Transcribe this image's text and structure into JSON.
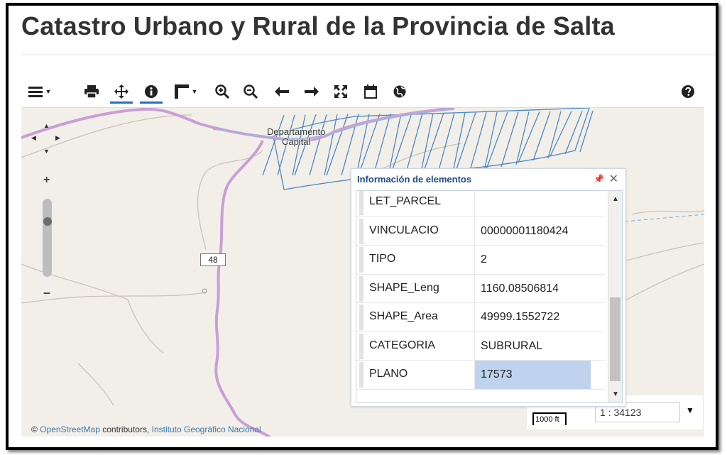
{
  "page": {
    "title": "Catastro Urbano y Rural de la Provincia de Salta"
  },
  "toolbar": {
    "tools": [
      {
        "id": "menu",
        "icon": "hamburger-menu-icon"
      },
      {
        "id": "print",
        "icon": "print-icon"
      },
      {
        "id": "pan",
        "icon": "move-icon"
      },
      {
        "id": "info",
        "icon": "info-icon"
      },
      {
        "id": "measure",
        "icon": "measure-ruler-icon"
      },
      {
        "id": "zoom-in",
        "icon": "zoom-in-icon"
      },
      {
        "id": "zoom-out",
        "icon": "zoom-out-icon"
      },
      {
        "id": "back",
        "icon": "arrow-left-icon"
      },
      {
        "id": "forward",
        "icon": "arrow-right-icon"
      },
      {
        "id": "full-extent",
        "icon": "expand-icon"
      },
      {
        "id": "calendar",
        "icon": "calendar-icon"
      },
      {
        "id": "globe",
        "icon": "globe-icon"
      },
      {
        "id": "help",
        "icon": "help-icon"
      }
    ],
    "active_tools": [
      "pan",
      "info"
    ]
  },
  "map": {
    "place_label": "Departamento\nCapital",
    "route_number": "48",
    "attribution": {
      "osm": "OpenStreetMap",
      "middle": "contributors,",
      "ign": "Instituto Geográfico Nacional"
    },
    "scale": {
      "bar_label": "1000 ft",
      "value": "1 : 34123"
    },
    "colors": {
      "background": "#f2efe9",
      "road": "#c99fd6",
      "parcel": "#4a88c6"
    }
  },
  "info_panel": {
    "title": "Información de elementos",
    "rows": [
      {
        "key": "LET_PARCEL",
        "value": ""
      },
      {
        "key": "VINCULACIO",
        "value": "00000001180424"
      },
      {
        "key": "TIPO",
        "value": "2"
      },
      {
        "key": "SHAPE_Leng",
        "value": "1160.08506814"
      },
      {
        "key": "SHAPE_Area",
        "value": "49999.1552722"
      },
      {
        "key": "CATEGORIA",
        "value": "SUBRURAL"
      },
      {
        "key": "PLANO",
        "value": "17573"
      }
    ],
    "selected_key": "PLANO"
  }
}
